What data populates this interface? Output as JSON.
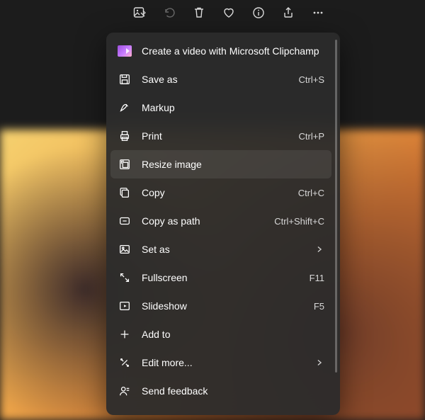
{
  "toolbar": {
    "items": [
      {
        "name": "edit-image-icon"
      },
      {
        "name": "rotate-icon"
      },
      {
        "name": "delete-icon"
      },
      {
        "name": "favorite-icon"
      },
      {
        "name": "info-icon"
      },
      {
        "name": "share-icon"
      },
      {
        "name": "more-icon"
      }
    ]
  },
  "menu": {
    "items": [
      {
        "icon": "clipchamp-icon",
        "label": "Create a video with Microsoft Clipchamp",
        "shortcut": null,
        "submenu": false,
        "hover": false
      },
      {
        "icon": "save-as-icon",
        "label": "Save as",
        "shortcut": "Ctrl+S",
        "submenu": false,
        "hover": false
      },
      {
        "icon": "markup-icon",
        "label": "Markup",
        "shortcut": null,
        "submenu": false,
        "hover": false
      },
      {
        "icon": "print-icon",
        "label": "Print",
        "shortcut": "Ctrl+P",
        "submenu": false,
        "hover": false
      },
      {
        "icon": "resize-icon",
        "label": "Resize image",
        "shortcut": null,
        "submenu": false,
        "hover": true
      },
      {
        "icon": "copy-icon",
        "label": "Copy",
        "shortcut": "Ctrl+C",
        "submenu": false,
        "hover": false
      },
      {
        "icon": "copy-path-icon",
        "label": "Copy as path",
        "shortcut": "Ctrl+Shift+C",
        "submenu": false,
        "hover": false
      },
      {
        "icon": "set-as-icon",
        "label": "Set as",
        "shortcut": null,
        "submenu": true,
        "hover": false
      },
      {
        "icon": "fullscreen-icon",
        "label": "Fullscreen",
        "shortcut": "F11",
        "submenu": false,
        "hover": false
      },
      {
        "icon": "slideshow-icon",
        "label": "Slideshow",
        "shortcut": "F5",
        "submenu": false,
        "hover": false
      },
      {
        "icon": "add-to-icon",
        "label": "Add to",
        "shortcut": null,
        "submenu": false,
        "hover": false
      },
      {
        "icon": "edit-more-icon",
        "label": "Edit more...",
        "shortcut": null,
        "submenu": true,
        "hover": false
      },
      {
        "icon": "feedback-icon",
        "label": "Send feedback",
        "shortcut": null,
        "submenu": false,
        "hover": false
      }
    ]
  }
}
